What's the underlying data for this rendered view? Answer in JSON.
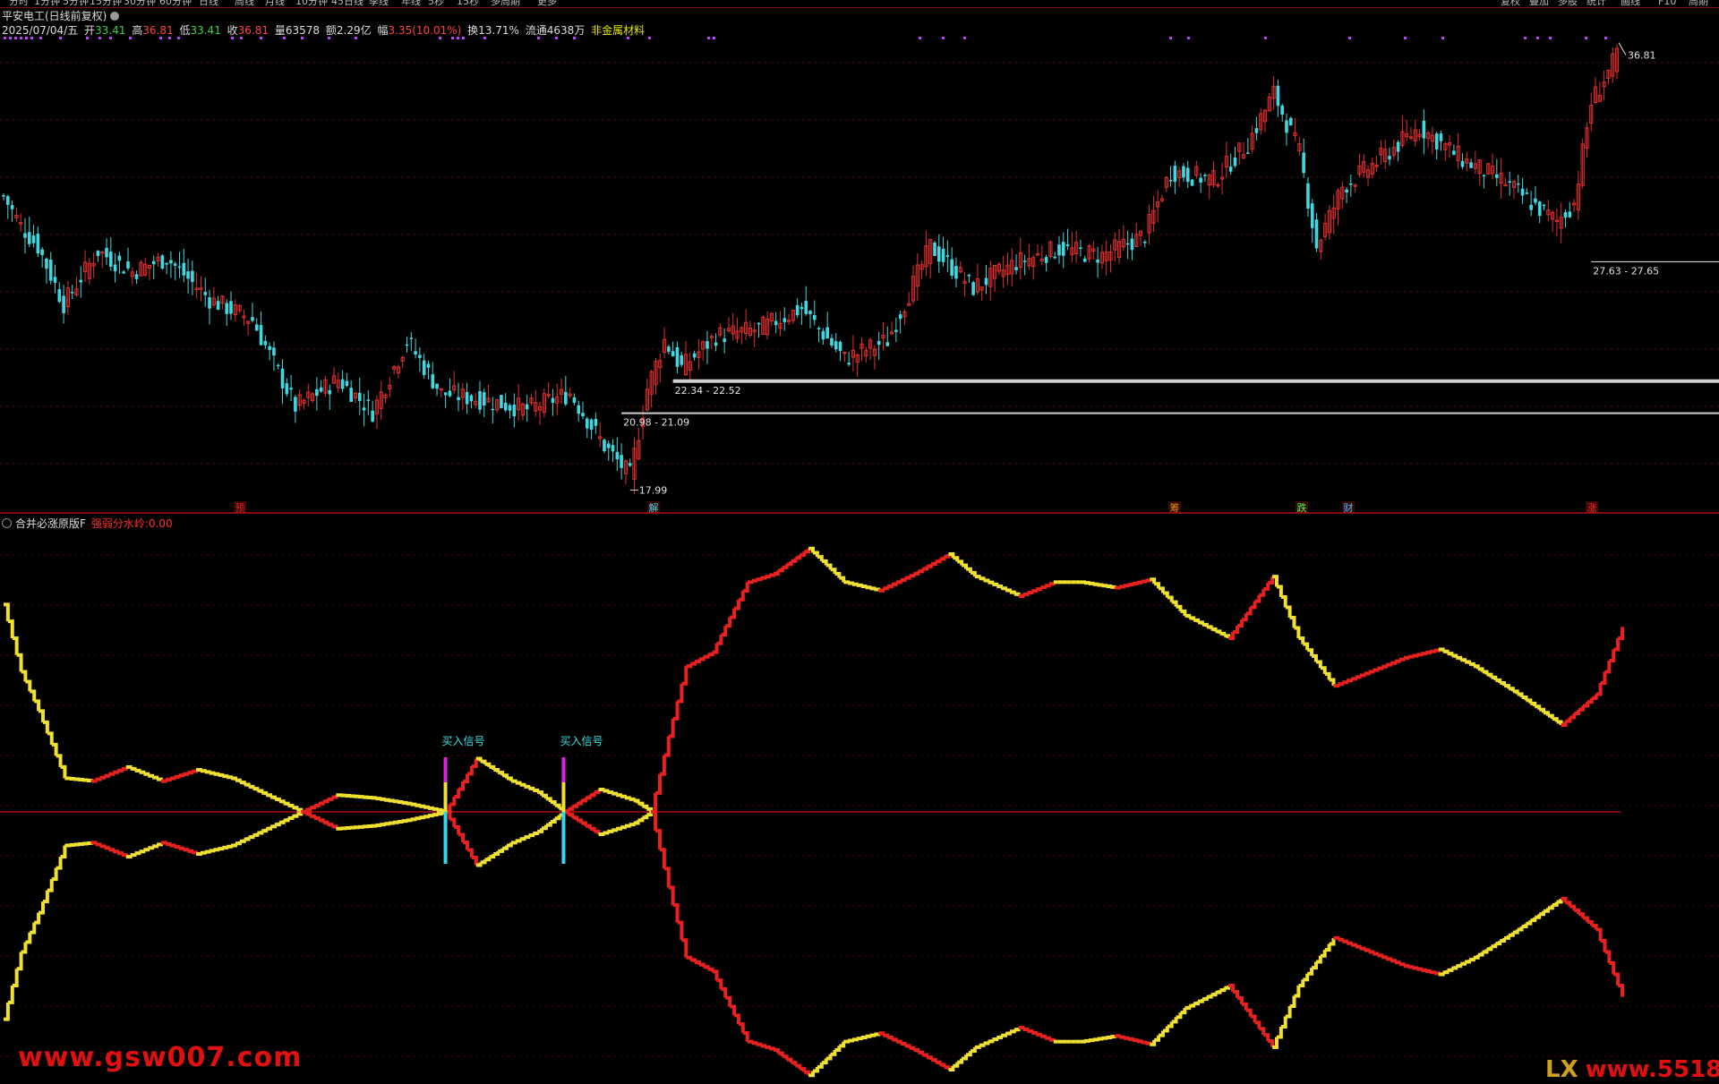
{
  "top_tabs": [
    "分时",
    "1分钟",
    "5分钟",
    "15分钟",
    "30分钟",
    "60分钟",
    "日线",
    "周线",
    "月线",
    "10分钟",
    "45日线",
    "季线",
    "年线",
    "5秒",
    "15秒",
    "多周期",
    "更多"
  ],
  "top_right_buttons": [
    "复权",
    "叠加",
    "多股",
    "统计",
    "画线",
    "F10",
    "周期"
  ],
  "stock_title": "平安电工(日线前复权)",
  "quote": {
    "date": "2025/07/04/五",
    "open_label": "开",
    "open": "33.41",
    "high_label": "高",
    "high": "36.81",
    "low_label": "低",
    "low": "33.41",
    "close_label": "收",
    "close": "36.81",
    "volume_label": "量",
    "volume": "63578",
    "amount_label": "额",
    "amount": "2.29亿",
    "change_label": "幅",
    "change": "3.35(10.01%)",
    "turnover_label": "换",
    "turnover": "13.71%",
    "float_label": "流通",
    "float": "4638万",
    "sector": "非金属材料"
  },
  "indicator": {
    "name": "合并必涨原版F",
    "strength_label": "强弱分水岭:",
    "strength_value": "0.00"
  },
  "buy_signal_label": "买入信号",
  "colors": {
    "up": "#e03030",
    "down": "#40d8e0",
    "curve_up": "#e82020",
    "curve_down": "#f0e030",
    "axis": "#cc1010"
  },
  "watermark_left": "www.gsw007.com",
  "watermark_right_logo": "LX",
  "watermark_right": "www.55188.com",
  "chart_data": [
    {
      "type": "candlestick",
      "title": "",
      "xlabel": "",
      "ylabel": "",
      "ylim": [
        17.5,
        37.5
      ],
      "grid": true,
      "labels": {
        "high_mark": "36.81",
        "low_mark": "17.99",
        "zone1": "22.34 - 22.52",
        "zone2": "20.98 - 21.09",
        "zone3": "27.63 - 27.65"
      },
      "price_lines": [
        22.43,
        21.03,
        27.64
      ],
      "event_marks": [
        "预",
        "解",
        "筹",
        "跌",
        "财",
        "涨"
      ],
      "trend_anchors": [
        [
          0,
          30.5
        ],
        [
          4,
          29.2
        ],
        [
          8,
          28.3
        ],
        [
          14,
          25.8
        ],
        [
          22,
          28.1
        ],
        [
          30,
          27.2
        ],
        [
          38,
          27.8
        ],
        [
          48,
          26.0
        ],
        [
          58,
          25.1
        ],
        [
          68,
          21.3
        ],
        [
          78,
          22.5
        ],
        [
          86,
          21.1
        ],
        [
          94,
          24.2
        ],
        [
          102,
          21.9
        ],
        [
          112,
          21.6
        ],
        [
          122,
          21.2
        ],
        [
          132,
          21.9
        ],
        [
          140,
          19.6
        ],
        [
          146,
          18.3
        ],
        [
          150,
          22.1
        ],
        [
          154,
          24.2
        ],
        [
          158,
          23.0
        ],
        [
          166,
          24.4
        ],
        [
          176,
          24.7
        ],
        [
          186,
          25.6
        ],
        [
          196,
          23.4
        ],
        [
          206,
          24.2
        ],
        [
          216,
          28.3
        ],
        [
          226,
          26.5
        ],
        [
          236,
          27.6
        ],
        [
          246,
          28.2
        ],
        [
          256,
          27.9
        ],
        [
          266,
          28.8
        ],
        [
          272,
          31.6
        ],
        [
          282,
          31.2
        ],
        [
          290,
          32.8
        ],
        [
          296,
          35.0
        ],
        [
          302,
          32.4
        ],
        [
          306,
          28.3
        ],
        [
          312,
          30.9
        ],
        [
          320,
          32.0
        ],
        [
          330,
          33.5
        ],
        [
          340,
          32.1
        ],
        [
          350,
          31.1
        ],
        [
          356,
          30.2
        ],
        [
          362,
          29.4
        ],
        [
          366,
          30.2
        ],
        [
          370,
          34.6
        ],
        [
          376,
          36.6
        ]
      ]
    },
    {
      "type": "line",
      "title": "",
      "xlabel": "",
      "ylabel": "",
      "ylim": [
        -100,
        100
      ],
      "grid": true,
      "series": [],
      "zero_line": 0,
      "buy_signals_at": [
        101,
        128
      ],
      "anchors": [
        [
          0,
          74
        ],
        [
          4,
          50
        ],
        [
          8,
          36
        ],
        [
          14,
          12
        ],
        [
          20,
          11
        ],
        [
          28,
          16
        ],
        [
          36,
          11
        ],
        [
          44,
          15
        ],
        [
          52,
          12
        ],
        [
          60,
          6
        ],
        [
          68,
          0
        ],
        [
          76,
          6
        ],
        [
          84,
          5
        ],
        [
          92,
          3
        ],
        [
          101,
          0
        ],
        [
          108,
          19
        ],
        [
          116,
          11
        ],
        [
          122,
          7
        ],
        [
          128,
          0
        ],
        [
          136,
          8
        ],
        [
          144,
          4
        ],
        [
          148,
          0
        ],
        [
          152,
          27
        ],
        [
          156,
          52
        ],
        [
          162,
          57
        ],
        [
          170,
          82
        ],
        [
          176,
          85
        ],
        [
          184,
          94
        ],
        [
          192,
          82
        ],
        [
          200,
          79
        ],
        [
          208,
          85
        ],
        [
          216,
          92
        ],
        [
          222,
          84
        ],
        [
          232,
          77
        ],
        [
          240,
          82
        ],
        [
          246,
          82
        ],
        [
          254,
          80
        ],
        [
          262,
          83
        ],
        [
          270,
          70
        ],
        [
          280,
          62
        ],
        [
          290,
          84
        ],
        [
          296,
          62
        ],
        [
          304,
          45
        ],
        [
          312,
          50
        ],
        [
          320,
          55
        ],
        [
          328,
          58
        ],
        [
          336,
          52
        ],
        [
          346,
          42
        ],
        [
          356,
          31
        ],
        [
          364,
          42
        ],
        [
          370,
          66
        ]
      ]
    }
  ]
}
